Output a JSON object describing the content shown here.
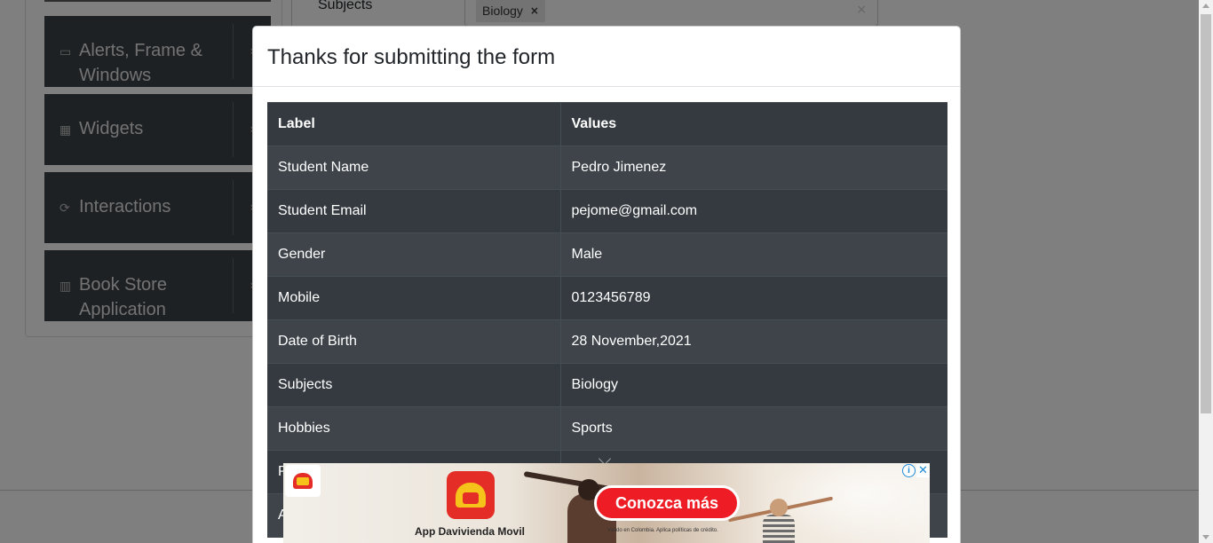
{
  "sidebar": {
    "items": [
      {
        "icon": "window-icon",
        "glyph": "▭",
        "label_line1": "Alerts, Frame &",
        "label_line2": "Windows"
      },
      {
        "icon": "widgets-icon",
        "glyph": "▦",
        "label": "Widgets"
      },
      {
        "icon": "interactions-icon",
        "glyph": "⟳",
        "label": "Interactions"
      },
      {
        "icon": "books-icon",
        "glyph": "▥",
        "label_line1": "Book Store",
        "label_line2": "Application"
      }
    ],
    "chevron": "›"
  },
  "form": {
    "subjects_label": "Subjects",
    "subject_chip": "Biology",
    "chip_remove": "×",
    "clear_all": "×"
  },
  "modal": {
    "title": "Thanks for submitting the form",
    "headers": {
      "label": "Label",
      "values": "Values"
    },
    "rows": [
      {
        "label": "Student Name",
        "value": "Pedro Jimenez"
      },
      {
        "label": "Student Email",
        "value": "pejome@gmail.com"
      },
      {
        "label": "Gender",
        "value": "Male"
      },
      {
        "label": "Mobile",
        "value": "0123456789"
      },
      {
        "label": "Date of Birth",
        "value": "28 November,2021"
      },
      {
        "label": "Subjects",
        "value": "Biology"
      },
      {
        "label": "Hobbies",
        "value": "Sports"
      },
      {
        "label": "P",
        "value": ""
      },
      {
        "label": "A",
        "value": ""
      }
    ]
  },
  "ad": {
    "cta": "Conozca más",
    "app_name": "App Davivienda Movil",
    "fine_print": "Válido en Colombia. Aplica políticas de crédito.",
    "info": "i",
    "close": "✕",
    "colors": {
      "brand_red": "#e52d27",
      "brand_yellow": "#f6c31b",
      "cta_red": "#ee1c25",
      "adchoices_blue": "#1c8ad6"
    }
  }
}
